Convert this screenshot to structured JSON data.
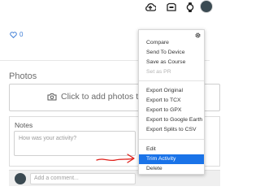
{
  "header": {
    "icons": [
      "upload-icon",
      "device-icon",
      "watch-icon"
    ]
  },
  "like": {
    "count": "0"
  },
  "photos": {
    "title": "Photos",
    "add_label": "Click to add photos to you"
  },
  "notes": {
    "title": "Notes",
    "placeholder": "How was your activity?"
  },
  "comment": {
    "placeholder": "Add a comment..."
  },
  "menu": {
    "group1": [
      "Compare",
      "Send To Device",
      "Save as Course",
      "Set as PR"
    ],
    "group2": [
      "Export Original",
      "Export to TCX",
      "Export to GPX",
      "Export to Google Earth",
      "Export Splits to CSV"
    ],
    "group3": [
      "Edit",
      "Trim Activity",
      "Delete"
    ],
    "disabled_item": "Set as PR",
    "highlighted_item": "Trim Activity"
  },
  "colors": {
    "accent": "#1a73e8",
    "annotation": "#e0201a",
    "link": "#3a7bd5"
  }
}
